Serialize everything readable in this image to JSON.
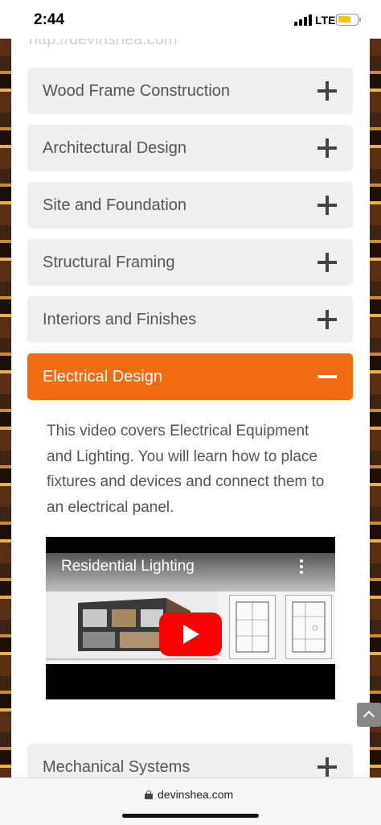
{
  "status_bar": {
    "time": "2:44",
    "network": "LTE"
  },
  "page": {
    "faded_url": "http://devinshea.com",
    "accordion": [
      {
        "label": "Wood Frame Construction",
        "expanded": false
      },
      {
        "label": "Architectural Design",
        "expanded": false
      },
      {
        "label": "Site and Foundation",
        "expanded": false
      },
      {
        "label": "Structural Framing",
        "expanded": false
      },
      {
        "label": "Interiors and Finishes",
        "expanded": false
      },
      {
        "label": "Electrical Design",
        "expanded": true
      }
    ],
    "expanded_description": "This video covers Electrical Equipment and Lighting. You will learn how to place fixtures and devices and connect them to an electrical panel.",
    "video": {
      "title": "Residential Lighting"
    },
    "next_section": {
      "label": "Mechanical Systems",
      "expanded": false
    }
  },
  "browser": {
    "domain": "devinshea.com"
  },
  "colors": {
    "accent": "#f06b12",
    "accordion_bg": "#efefef",
    "youtube_red": "#ff0000"
  }
}
